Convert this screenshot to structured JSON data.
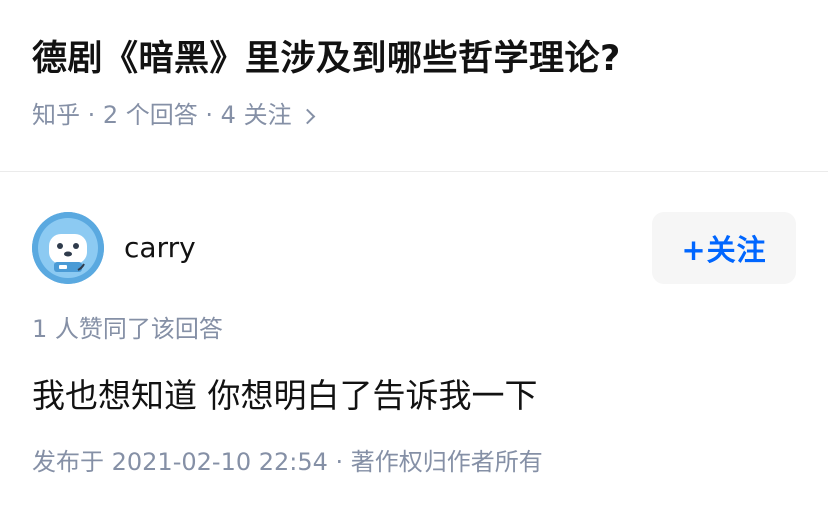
{
  "question": {
    "title": "德剧《暗黑》里涉及到哪些哲学理论?",
    "meta": "知乎 · 2 个回答 · 4 关注"
  },
  "answer": {
    "author_name": "carry",
    "follow_label": "+关注",
    "vote_text": "1 人赞同了该回答",
    "content": "我也想知道 你想明白了告诉我一下",
    "footer": "发布于 2021-02-10 22:54 · 著作权归作者所有"
  },
  "colors": {
    "accent": "#0066ff",
    "muted": "#8590a6",
    "text": "#121212",
    "avatar_bg": "#5aa9e0"
  }
}
